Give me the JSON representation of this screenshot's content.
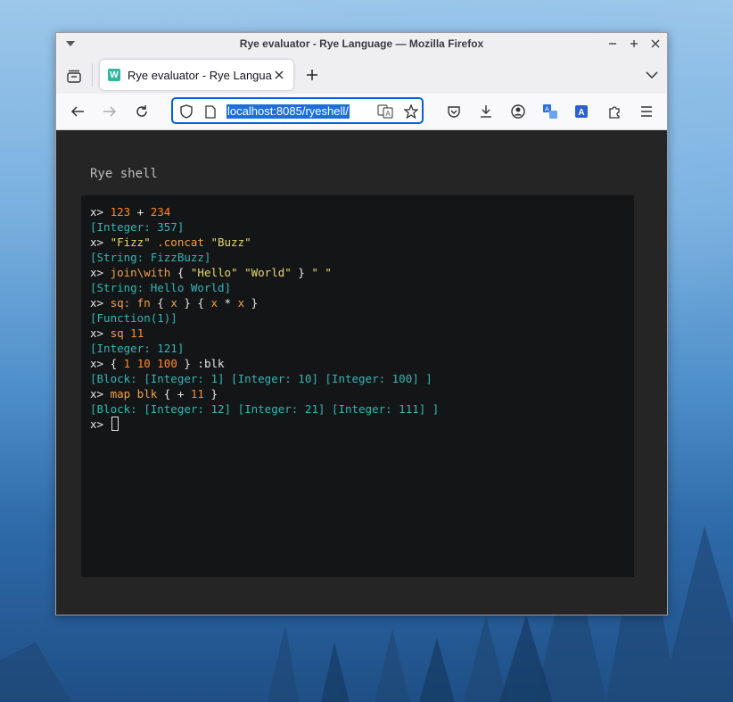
{
  "window": {
    "title": "Rye evaluator - Rye Language — Mozilla Firefox"
  },
  "tabs": [
    {
      "label": "Rye evaluator - Rye Language",
      "favicon": "W"
    }
  ],
  "urlbar": {
    "url": "localhost:8085/ryeshell/"
  },
  "page": {
    "heading": "Rye shell"
  },
  "terminal": {
    "lines": [
      [
        {
          "t": "x> ",
          "c": "prompt"
        },
        {
          "t": "123",
          "c": "num"
        },
        {
          "t": " + ",
          "c": "op"
        },
        {
          "t": "234",
          "c": "num"
        }
      ],
      [
        {
          "t": "[Integer: 357]",
          "c": "res"
        }
      ],
      [
        {
          "t": "x> ",
          "c": "prompt"
        },
        {
          "t": "\"Fizz\"",
          "c": "str"
        },
        {
          "t": " .concat ",
          "c": "word"
        },
        {
          "t": "\"Buzz\"",
          "c": "str"
        }
      ],
      [
        {
          "t": "[String: FizzBuzz]",
          "c": "res"
        }
      ],
      [
        {
          "t": "x> ",
          "c": "prompt"
        },
        {
          "t": "join\\with",
          "c": "word"
        },
        {
          "t": " { ",
          "c": "sym"
        },
        {
          "t": "\"Hello\" \"World\"",
          "c": "str"
        },
        {
          "t": " } ",
          "c": "sym"
        },
        {
          "t": "\" \"",
          "c": "str"
        }
      ],
      [
        {
          "t": "[String: Hello World]",
          "c": "res"
        }
      ],
      [
        {
          "t": "x> ",
          "c": "prompt"
        },
        {
          "t": "sq: fn",
          "c": "word"
        },
        {
          "t": " { ",
          "c": "sym"
        },
        {
          "t": "x",
          "c": "word"
        },
        {
          "t": " } { ",
          "c": "sym"
        },
        {
          "t": "x",
          "c": "word"
        },
        {
          "t": " * ",
          "c": "op"
        },
        {
          "t": "x",
          "c": "word"
        },
        {
          "t": " }",
          "c": "sym"
        }
      ],
      [
        {
          "t": "[Function(1)]",
          "c": "res"
        }
      ],
      [
        {
          "t": "x> ",
          "c": "prompt"
        },
        {
          "t": "sq",
          "c": "word"
        },
        {
          "t": " ",
          "c": "sym"
        },
        {
          "t": "11",
          "c": "num"
        }
      ],
      [
        {
          "t": "[Integer: 121]",
          "c": "res"
        }
      ],
      [
        {
          "t": "x> ",
          "c": "prompt"
        },
        {
          "t": "{ ",
          "c": "sym"
        },
        {
          "t": "1 10 100",
          "c": "num"
        },
        {
          "t": " } :blk",
          "c": "sym"
        }
      ],
      [
        {
          "t": "[Block: [Integer: 1] [Integer: 10] [Integer: 100] ]",
          "c": "res"
        }
      ],
      [
        {
          "t": "x> ",
          "c": "prompt"
        },
        {
          "t": "map blk",
          "c": "word"
        },
        {
          "t": " { + ",
          "c": "sym"
        },
        {
          "t": "11",
          "c": "num"
        },
        {
          "t": " }",
          "c": "sym"
        }
      ],
      [
        {
          "t": "[Block: [Integer: 12] [Integer: 21] [Integer: 111] ]",
          "c": "res"
        }
      ]
    ],
    "input_prompt": "x> "
  },
  "colors": {
    "accent": "#0061e0",
    "terminal_bg": "#141516",
    "page_bg": "#252526",
    "number": "#ff8a2a",
    "string": "#e6d96a",
    "word": "#f0a34a",
    "result": "#33b6b5"
  },
  "icons": {
    "window_menu": "chevron-down-icon",
    "minimize": "minimize-icon",
    "maximize": "maximize-icon",
    "close": "close-icon",
    "tab_overview": "tab-overview-icon",
    "back": "back-arrow-icon",
    "forward": "forward-arrow-icon",
    "reload": "reload-icon",
    "tracking": "shield-icon",
    "page_info": "page-icon",
    "translate": "translate-icon",
    "bookmark": "star-icon",
    "pocket": "pocket-icon",
    "downloads": "download-icon",
    "account": "account-icon",
    "extensions": "puzzle-icon",
    "menu": "hamburger-menu-icon"
  }
}
